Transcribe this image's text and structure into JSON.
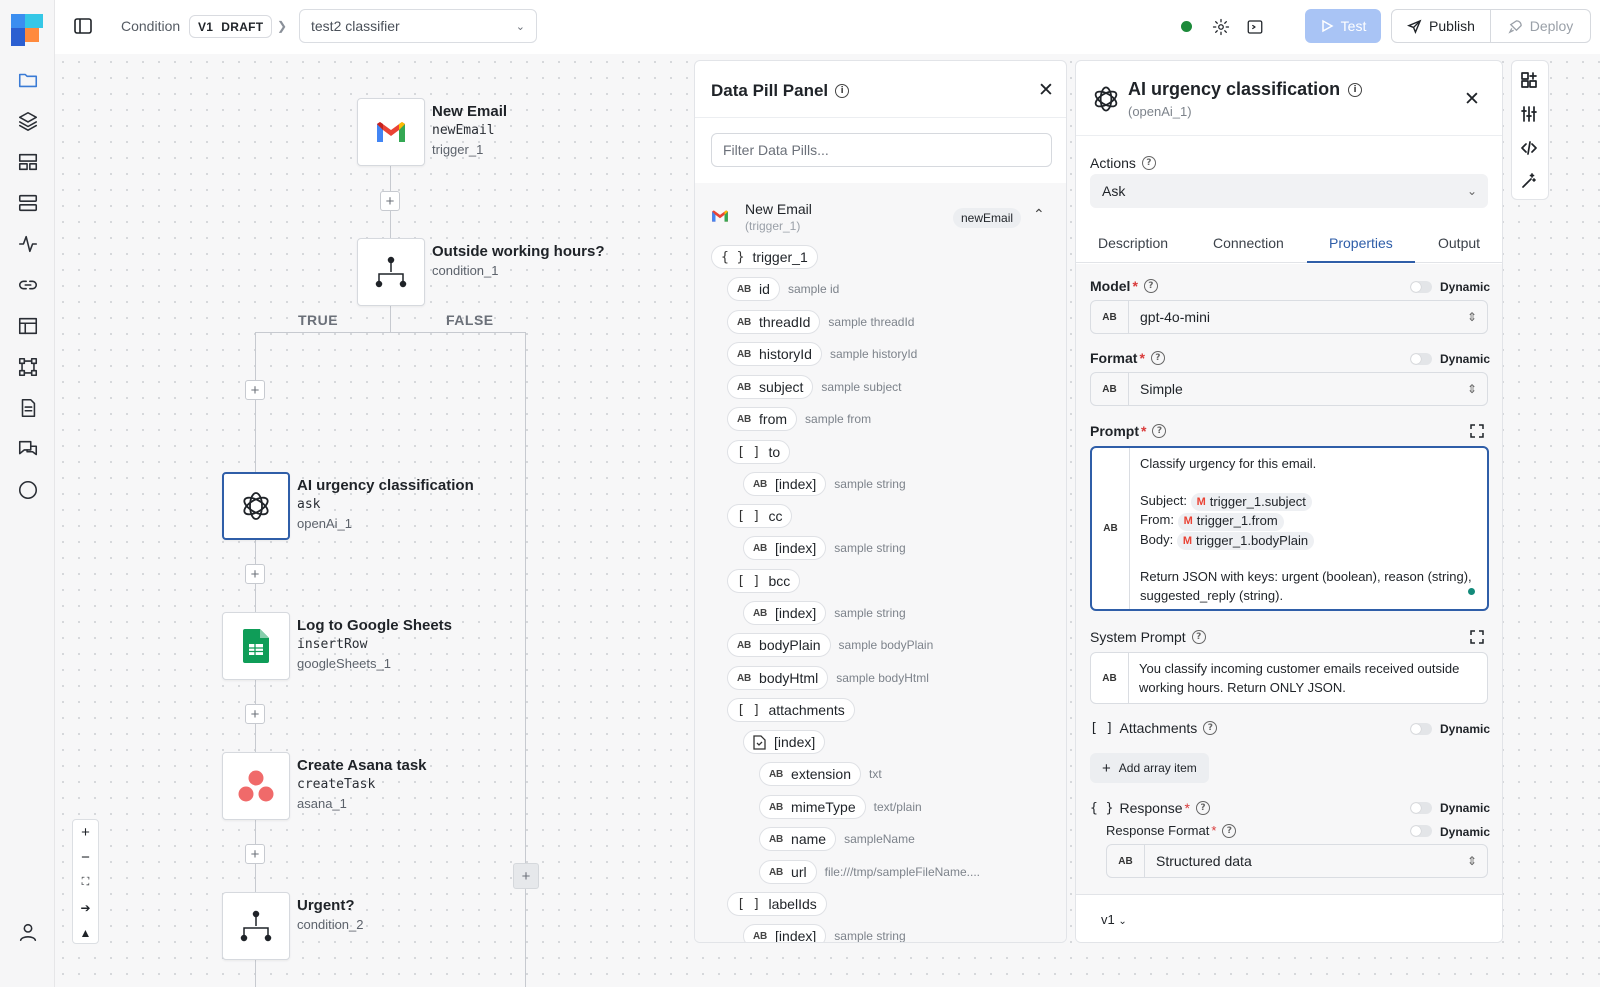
{
  "breadcrumb": {
    "section": "Condition",
    "version": "V1",
    "version_state": "DRAFT",
    "flow_name": "test2 classifier"
  },
  "toolbar": {
    "test_label": "Test",
    "publish_label": "Publish",
    "deploy_label": "Deploy"
  },
  "flow": {
    "branch_true": "TRUE",
    "branch_false": "FALSE",
    "nodes": [
      {
        "title": "New Email",
        "action": "newEmail",
        "id": "trigger_1",
        "icon": "gmail-icon"
      },
      {
        "title": "Outside working hours?",
        "action": "",
        "id": "condition_1",
        "icon": "branch-icon"
      },
      {
        "title": "AI urgency classification",
        "action": "ask",
        "id": "openAi_1",
        "icon": "openai-icon"
      },
      {
        "title": "Log to Google Sheets",
        "action": "insertRow",
        "id": "googleSheets_1",
        "icon": "google-sheets-icon"
      },
      {
        "title": "Create Asana task",
        "action": "createTask",
        "id": "asana_1",
        "icon": "asana-icon"
      },
      {
        "title": "Urgent?",
        "action": "",
        "id": "condition_2",
        "icon": "branch-icon"
      }
    ]
  },
  "data_pill_panel": {
    "title": "Data Pill Panel",
    "filter_placeholder": "Filter Data Pills...",
    "source": {
      "name": "New Email",
      "id": "(trigger_1)",
      "badge": "newEmail"
    },
    "root": "trigger_1",
    "pills": [
      {
        "type": "AB",
        "name": "id",
        "sample": "sample id"
      },
      {
        "type": "AB",
        "name": "threadId",
        "sample": "sample threadId"
      },
      {
        "type": "AB",
        "name": "historyId",
        "sample": "sample historyId"
      },
      {
        "type": "AB",
        "name": "subject",
        "sample": "sample subject"
      },
      {
        "type": "AB",
        "name": "from",
        "sample": "sample from"
      },
      {
        "type": "[]",
        "name": "to",
        "sample": ""
      },
      {
        "type": "AB",
        "name": "[index]",
        "sample": "sample string"
      },
      {
        "type": "[]",
        "name": "cc",
        "sample": ""
      },
      {
        "type": "AB",
        "name": "[index]",
        "sample": "sample string"
      },
      {
        "type": "[]",
        "name": "bcc",
        "sample": ""
      },
      {
        "type": "AB",
        "name": "[index]",
        "sample": "sample string"
      },
      {
        "type": "AB",
        "name": "bodyPlain",
        "sample": "sample bodyPlain"
      },
      {
        "type": "AB",
        "name": "bodyHtml",
        "sample": "sample bodyHtml"
      },
      {
        "type": "[]",
        "name": "attachments",
        "sample": ""
      },
      {
        "type": "file",
        "name": "[index]",
        "sample": ""
      },
      {
        "type": "AB",
        "name": "extension",
        "sample": "txt"
      },
      {
        "type": "AB",
        "name": "mimeType",
        "sample": "text/plain"
      },
      {
        "type": "AB",
        "name": "name",
        "sample": "sampleName"
      },
      {
        "type": "AB",
        "name": "url",
        "sample": "file:///tmp/sampleFileName...."
      },
      {
        "type": "[]",
        "name": "labelIds",
        "sample": ""
      },
      {
        "type": "AB",
        "name": "[index]",
        "sample": "sample string"
      }
    ]
  },
  "properties_panel": {
    "title": "AI urgency classification",
    "subtitle": "(openAi_1)",
    "actions_label": "Actions",
    "actions_value": "Ask",
    "tabs": [
      "Description",
      "Connection",
      "Properties",
      "Output"
    ],
    "active_tab": "Properties",
    "dynamic_label": "Dynamic",
    "model_label": "Model",
    "model_value": "gpt-4o-mini",
    "format_label": "Format",
    "format_value": "Simple",
    "prompt_label": "Prompt",
    "prompt": {
      "line1": "Classify urgency for this email.",
      "subject_label": "Subject:",
      "subject_pill": "trigger_1.subject",
      "from_label": "From:",
      "from_pill": "trigger_1.from",
      "body_label": "Body:",
      "body_pill": "trigger_1.bodyPlain",
      "line_last": "Return JSON with keys: urgent (boolean), reason (string), suggested_reply (string)."
    },
    "system_prompt_label": "System Prompt",
    "system_prompt_value": "You classify incoming customer emails received outside working hours. Return ONLY JSON.",
    "attachments_label": "Attachments",
    "add_array_label": "Add array item",
    "response_label": "Response",
    "response_format_label": "Response Format",
    "response_format_value": "Structured data",
    "version_selector": "v1"
  },
  "colors": {
    "accent": "#2f5ea8",
    "test_button": "#a9c4f5",
    "status_dot": "#1c8a3a",
    "required": "#d93a3a"
  }
}
